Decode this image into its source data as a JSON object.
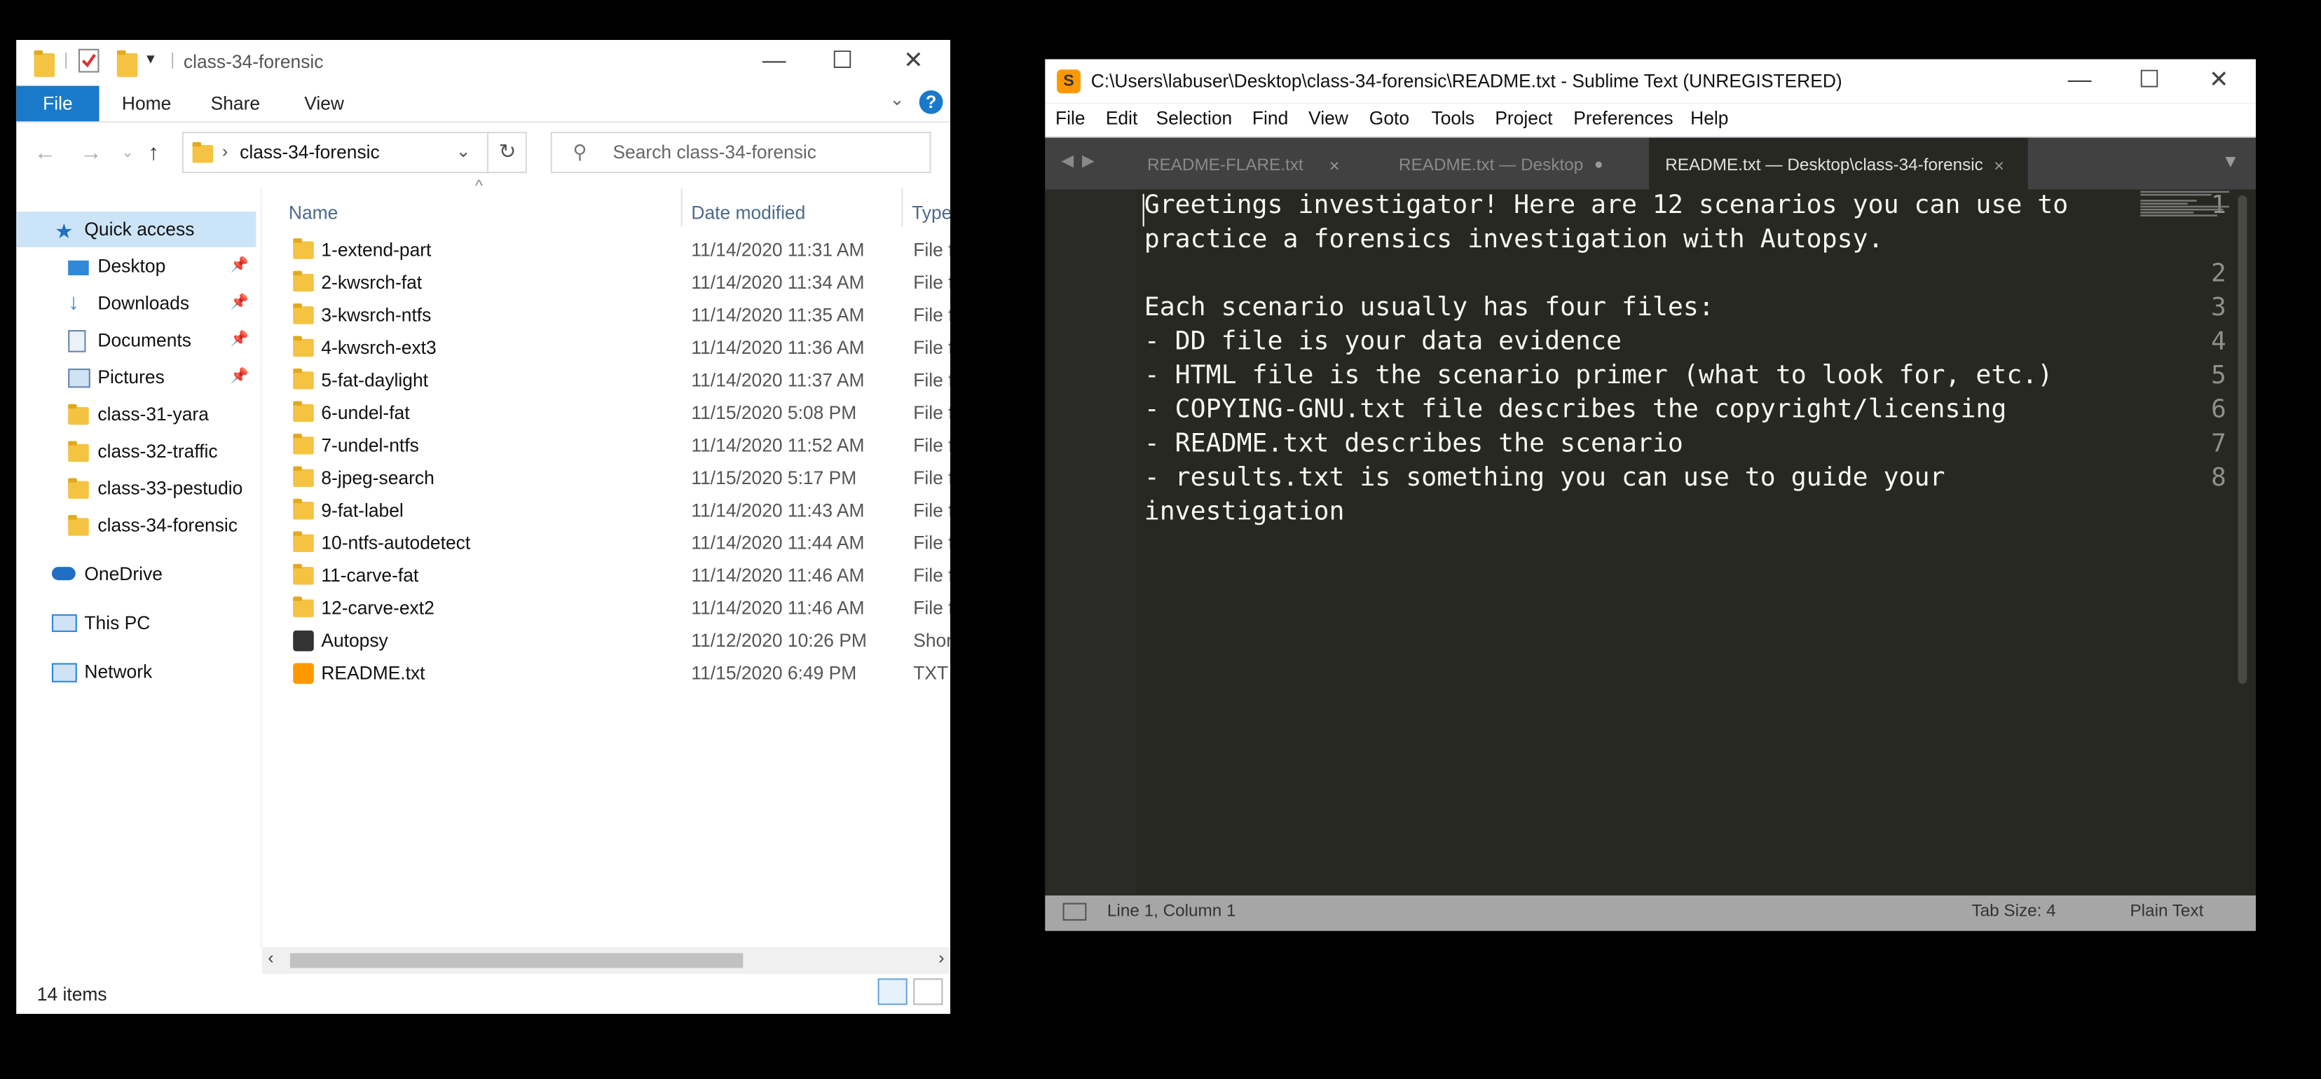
{
  "explorer": {
    "title": "class-34-forensic",
    "ribbon": {
      "file": "File",
      "home": "Home",
      "share": "Share",
      "view": "View"
    },
    "address": "class-34-forensic",
    "search_placeholder": "Search class-34-forensic",
    "columns": {
      "name": "Name",
      "date": "Date modified",
      "type": "Type"
    },
    "nav": [
      {
        "label": "Quick access",
        "icon": "star-icon"
      },
      {
        "label": "Desktop",
        "icon": "desktop-icon"
      },
      {
        "label": "Downloads",
        "icon": "download-icon"
      },
      {
        "label": "Documents",
        "icon": "documents-icon"
      },
      {
        "label": "Pictures",
        "icon": "pictures-icon"
      },
      {
        "label": "class-31-yara",
        "icon": "folder-icon"
      },
      {
        "label": "class-32-traffic",
        "icon": "folder-icon"
      },
      {
        "label": "class-33-pestudio",
        "icon": "folder-icon"
      },
      {
        "label": "class-34-forensic",
        "icon": "folder-icon"
      },
      {
        "label": "OneDrive",
        "icon": "cloud-icon"
      },
      {
        "label": "This PC",
        "icon": "pc-icon"
      },
      {
        "label": "Network",
        "icon": "network-icon"
      }
    ],
    "files": [
      {
        "name": "1-extend-part",
        "date": "11/14/2020 11:31 AM",
        "type": "File f"
      },
      {
        "name": "2-kwsrch-fat",
        "date": "11/14/2020 11:34 AM",
        "type": "File f"
      },
      {
        "name": "3-kwsrch-ntfs",
        "date": "11/14/2020 11:35 AM",
        "type": "File f"
      },
      {
        "name": "4-kwsrch-ext3",
        "date": "11/14/2020 11:36 AM",
        "type": "File f"
      },
      {
        "name": "5-fat-daylight",
        "date": "11/14/2020 11:37 AM",
        "type": "File f"
      },
      {
        "name": "6-undel-fat",
        "date": "11/15/2020 5:08 PM",
        "type": "File f"
      },
      {
        "name": "7-undel-ntfs",
        "date": "11/14/2020 11:52 AM",
        "type": "File f"
      },
      {
        "name": "8-jpeg-search",
        "date": "11/15/2020 5:17 PM",
        "type": "File f"
      },
      {
        "name": "9-fat-label",
        "date": "11/14/2020 11:43 AM",
        "type": "File f"
      },
      {
        "name": "10-ntfs-autodetect",
        "date": "11/14/2020 11:44 AM",
        "type": "File f"
      },
      {
        "name": "11-carve-fat",
        "date": "11/14/2020 11:46 AM",
        "type": "File f"
      },
      {
        "name": "12-carve-ext2",
        "date": "11/14/2020 11:46 AM",
        "type": "File f"
      },
      {
        "name": "Autopsy",
        "date": "11/12/2020 10:26 PM",
        "type": "Shor"
      },
      {
        "name": "README.txt",
        "date": "11/15/2020 6:49 PM",
        "type": "TXT"
      }
    ],
    "status": "14 items"
  },
  "sublime": {
    "title": "C:\\Users\\labuser\\Desktop\\class-34-forensic\\README.txt - Sublime Text (UNREGISTERED)",
    "menu": [
      "File",
      "Edit",
      "Selection",
      "Find",
      "View",
      "Goto",
      "Tools",
      "Project",
      "Preferences",
      "Help"
    ],
    "tabs": [
      {
        "label": "README-FLARE.txt",
        "marker": "×"
      },
      {
        "label": "README.txt — Desktop",
        "marker": "●"
      },
      {
        "label": "README.txt — Desktop\\class-34-forensic",
        "marker": "×"
      }
    ],
    "lines": [
      {
        "num": "1",
        "text": "Greetings investigator! Here are 12 scenarios you can use to"
      },
      {
        "num": "",
        "text": "practice a forensics investigation with Autopsy."
      },
      {
        "num": "2",
        "text": ""
      },
      {
        "num": "3",
        "text": "Each scenario usually has four files:"
      },
      {
        "num": "4",
        "text": "- DD file is your data evidence"
      },
      {
        "num": "5",
        "text": "- HTML file is the scenario primer (what to look for, etc.)"
      },
      {
        "num": "6",
        "text": "- COPYING-GNU.txt file describes the copyright/licensing"
      },
      {
        "num": "7",
        "text": "- README.txt describes the scenario"
      },
      {
        "num": "8",
        "text": "- results.txt is something you can use to guide your"
      },
      {
        "num": "",
        "text": "investigation"
      }
    ],
    "status": {
      "position": "Line 1, Column 1",
      "tab_size": "Tab Size: 4",
      "syntax": "Plain Text"
    }
  }
}
